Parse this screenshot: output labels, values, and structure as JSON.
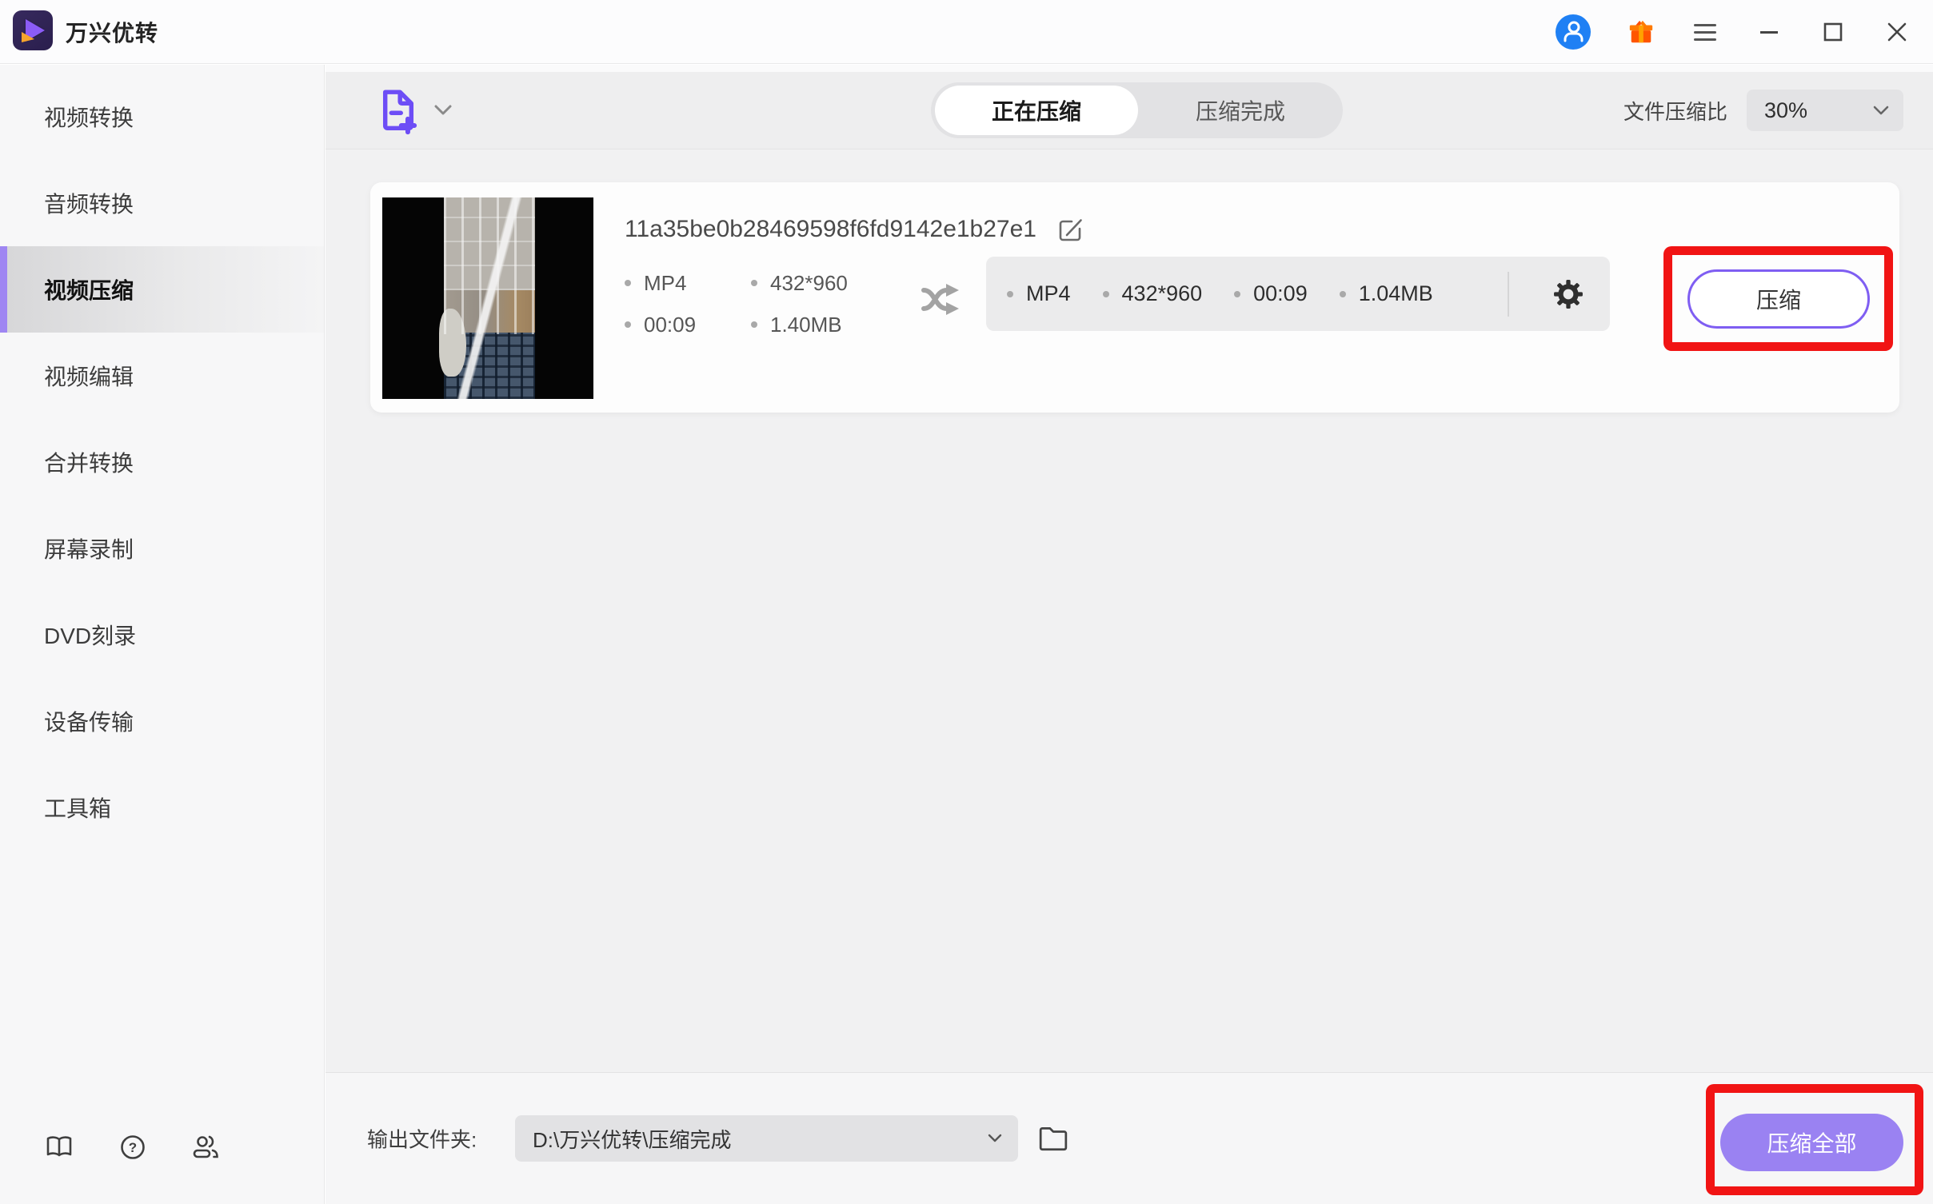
{
  "window": {
    "title": "万兴优转"
  },
  "sidebar": {
    "items": [
      {
        "label": "视频转换",
        "active": false
      },
      {
        "label": "音频转换",
        "active": false
      },
      {
        "label": "视频压缩",
        "active": true
      },
      {
        "label": "视频编辑",
        "active": false
      },
      {
        "label": "合并转换",
        "active": false
      },
      {
        "label": "屏幕录制",
        "active": false
      },
      {
        "label": "DVD刻录",
        "active": false
      },
      {
        "label": "设备传输",
        "active": false
      },
      {
        "label": "工具箱",
        "active": false
      }
    ]
  },
  "toolbar": {
    "tabs": [
      {
        "label": "正在压缩",
        "active": true
      },
      {
        "label": "压缩完成",
        "active": false
      }
    ],
    "ratio": {
      "label": "文件压缩比",
      "value": "30%"
    }
  },
  "file": {
    "name": "11a35be0b28469598f6fd9142e1b27e1",
    "source": {
      "format": "MP4",
      "resolution": "432*960",
      "duration": "00:09",
      "size": "1.40MB"
    },
    "target": {
      "format": "MP4",
      "resolution": "432*960",
      "duration": "00:09",
      "size": "1.04MB"
    },
    "actions": {
      "compress": "压缩"
    }
  },
  "footer": {
    "output": {
      "label": "输出文件夹:",
      "value": "D:\\万兴优转\\压缩完成"
    },
    "actions": {
      "compress_all": "压缩全部"
    }
  },
  "icons": {
    "question_mark": "?"
  },
  "colors": {
    "accent_purple": "#7f5ef2",
    "button_purple": "#9a82f2",
    "annotation_red": "#f11414",
    "avatar_blue": "#1f80f4",
    "gift_orange": "#ff6400"
  }
}
